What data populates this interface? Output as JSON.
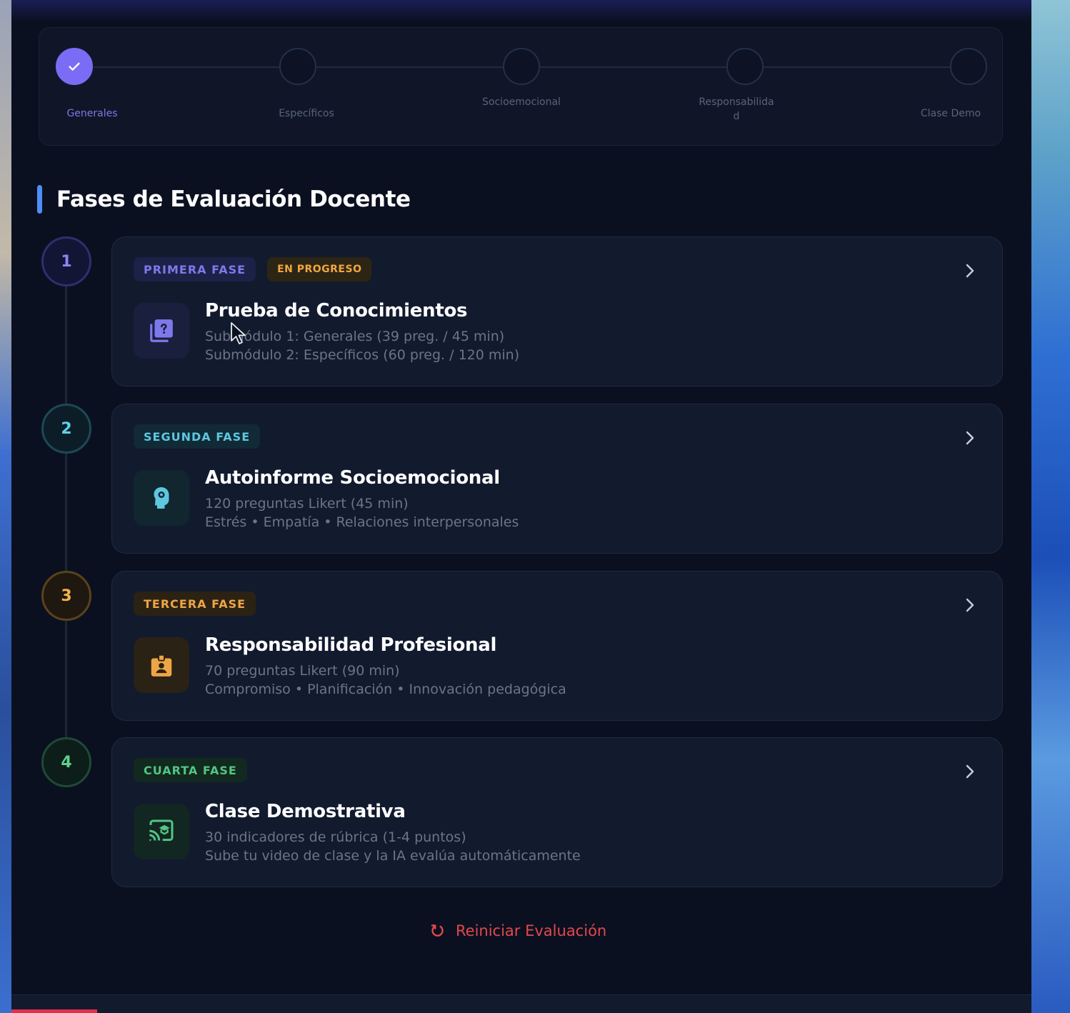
{
  "stepper": {
    "steps": [
      {
        "label": "Generales",
        "state": "done"
      },
      {
        "label": "Específicos",
        "state": "pending"
      },
      {
        "label": "Socioemocional",
        "state": "pending"
      },
      {
        "label": "Responsabilidad",
        "state": "pending"
      },
      {
        "label": "Clase Demo",
        "state": "pending"
      }
    ]
  },
  "section": {
    "title": "Fases de Evaluación Docente"
  },
  "phases": [
    {
      "number": "1",
      "badge": "PRIMERA FASE",
      "status": "EN PROGRESO",
      "title": "Prueba de Conocimientos",
      "line1": "Submódulo 1: Generales (39 preg. / 45 min)",
      "line2": "Submódulo 2: Específicos (60 preg. / 120 min)",
      "icon": "quiz-icon",
      "color": "#7d79ea"
    },
    {
      "number": "2",
      "badge": "SEGUNDA FASE",
      "title": "Autoinforme Socioemocional",
      "line1": "120 preguntas Likert (45 min)",
      "line2": "Estrés • Empatía • Relaciones interpersonales",
      "icon": "psychology-icon",
      "color": "#5dc7df"
    },
    {
      "number": "3",
      "badge": "TERCERA FASE",
      "title": "Responsabilidad Profesional",
      "line1": "70 preguntas Likert (90 min)",
      "line2": "Compromiso • Planificación • Innovación pedagógica",
      "icon": "badge-icon",
      "color": "#eea545"
    },
    {
      "number": "4",
      "badge": "CUARTA FASE",
      "title": "Clase Demostrativa",
      "line1": "30 indicadores de rúbrica (1-4 puntos)",
      "line2": "Sube tu video de clase y la IA evalúa automáticamente",
      "icon": "cast-for-education-icon",
      "color": "#52c585"
    }
  ],
  "reset": {
    "label": "Reiniciar Evaluación",
    "color": "#e4474d"
  }
}
